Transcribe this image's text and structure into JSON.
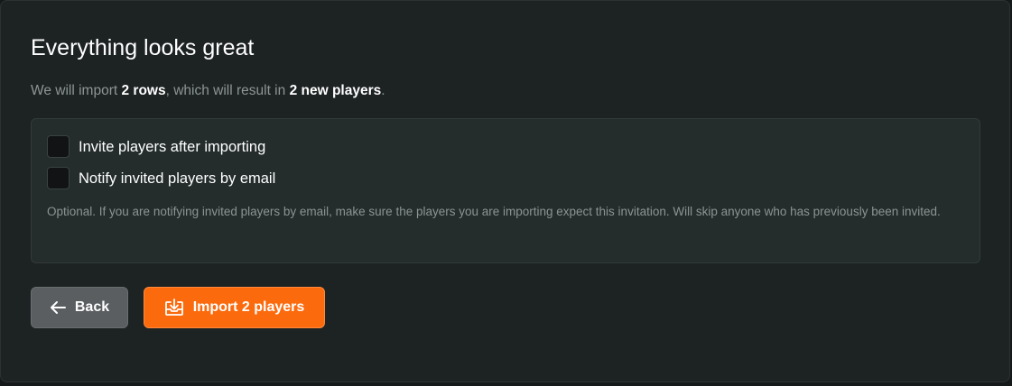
{
  "dialog": {
    "title": "Everything looks great",
    "summary": {
      "prefix": "We will import ",
      "rows": "2 rows",
      "middle": ", which will result in ",
      "players": "2 new players",
      "suffix": "."
    },
    "options": {
      "invite_label": "Invite players after importing",
      "invite_checked": false,
      "notify_label": "Notify invited players by email",
      "notify_checked": false,
      "help_text": "Optional. If you are notifying invited players by email, make sure the players you are importing expect this invitation. Will skip anyone who has previously been invited."
    },
    "actions": {
      "back_label": "Back",
      "back_icon": "arrow-left-icon",
      "import_label": "Import 2 players",
      "import_icon": "download-tray-icon"
    }
  },
  "colors": {
    "background": "#1d2222",
    "options_box": "#242d2c",
    "accent": "#fb6a0d",
    "back_button": "#5a5e60",
    "muted_text": "#8d9695"
  }
}
